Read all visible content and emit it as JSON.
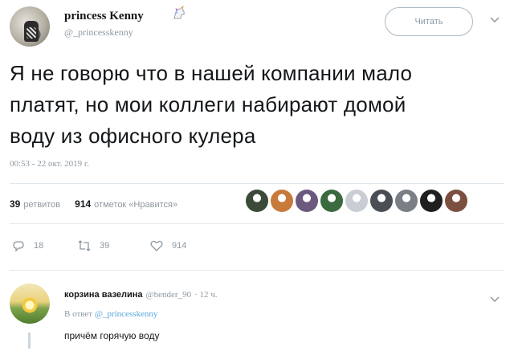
{
  "tweet": {
    "author": {
      "display_name": "princess Kenny",
      "handle": "@_princesskenny",
      "badge_icon": "unicorn-icon"
    },
    "follow_label": "Читать",
    "text_lines": [
      "Я не говорю что в нашей компании мало",
      "платят, но мои коллеги набирают домой",
      "воду из офисного кулера"
    ],
    "timestamp": "00:53 - 22 окт. 2019 г.",
    "stats": {
      "retweets_count": "39",
      "retweets_label": "ретвитов",
      "likes_count": "914",
      "likes_label": "отметок «Нравится»"
    },
    "liker_avatar_colors": [
      "#3c4a3a",
      "#c77a3a",
      "#6b5a7e",
      "#3a6a3e",
      "#c9ced4",
      "#4a4f55",
      "#7a7f86",
      "#1f1f1f",
      "#7c5040"
    ],
    "actions": {
      "replies": "18",
      "retweets": "39",
      "likes": "914"
    }
  },
  "reply": {
    "display_name": "корзина вазелина",
    "handle": "@bender_90",
    "time": "· 12 ч.",
    "reply_to_prefix": "В ответ",
    "reply_to_handle": "@_princesskenny",
    "text": "причём горячую воду"
  },
  "colors": {
    "link": "#5aa6dd",
    "muted": "#8e98a1",
    "divider": "#e1e8ed"
  }
}
